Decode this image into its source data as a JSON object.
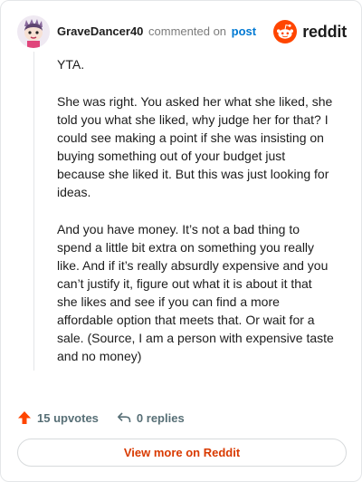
{
  "comment": {
    "username": "GraveDancer40",
    "action_text": "commented on",
    "link_text": "post",
    "paragraphs": [
      "YTA.",
      "She was right. You asked her what she liked, she told you what she liked, why judge her for that? I could see making a point if she was insisting on buying something out of your budget just because she liked it. But this was just looking for ideas.",
      "And you have money. It’s not a bad thing to spend a little bit extra on something you really like. And if it’s really absurdly expensive and you can’t justify it, figure out what it is about it that she likes and see if you can find a more affordable option that meets that. Or wait for a sale. (Source, I am a person with expensive taste and no money)"
    ]
  },
  "brand": {
    "name": "reddit",
    "icon": "reddit-alien-icon",
    "accent": "#ff4500"
  },
  "footer": {
    "upvotes": "15 upvotes",
    "replies": "0 replies",
    "view_more": "View more on Reddit"
  },
  "colors": {
    "link": "#0079d3",
    "upvote": "#ff4500",
    "view_more": "#d93a00",
    "muted": "#576f76"
  }
}
